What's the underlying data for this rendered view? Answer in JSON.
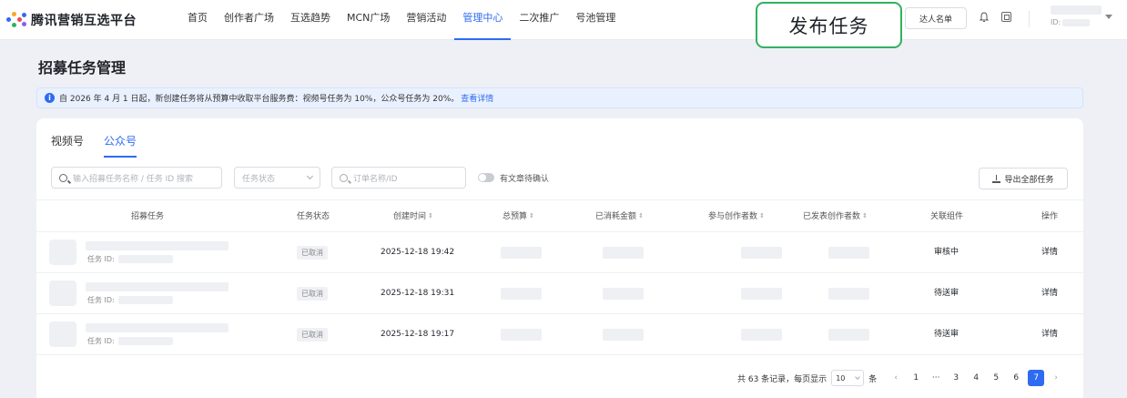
{
  "nav": {
    "logo_text": "腾讯营销互选平台",
    "items": [
      {
        "label": "首页",
        "active": false
      },
      {
        "label": "创作者广场",
        "active": false
      },
      {
        "label": "互选趋势",
        "active": false
      },
      {
        "label": "MCN广场",
        "active": false
      },
      {
        "label": "营销活动",
        "active": false
      },
      {
        "label": "管理中心",
        "active": true
      },
      {
        "label": "二次推广",
        "active": false
      },
      {
        "label": "号池管理",
        "active": false
      }
    ],
    "publish_label": "发布任务",
    "talent_list_label": "达人名单",
    "user_id_prefix": "ID:"
  },
  "page": {
    "title": "招募任务管理"
  },
  "notice": {
    "icon": "info-icon",
    "text": "自 2026 年 4 月 1 日起，新创建任务将从预算中收取平台服务费：视频号任务为 10%，公众号任务为 20%。",
    "link_text": "查看详情"
  },
  "tabs": [
    {
      "label": "视频号",
      "active": false
    },
    {
      "label": "公众号",
      "active": true
    }
  ],
  "filters": {
    "search_placeholder": "输入招募任务名称 / 任务 ID 搜索",
    "status_placeholder": "任务状态",
    "order_placeholder": "订单名称/ID",
    "toggle_label": "有文章待确认",
    "export_label": "导出全部任务"
  },
  "table": {
    "headers": {
      "task": "招募任务",
      "status": "任务状态",
      "created": "创建时间",
      "budget": "总预算",
      "consumed": "已消耗金额",
      "participants": "参与创作者数",
      "published": "已发表创作者数",
      "component": "关联组件",
      "action": "操作"
    },
    "task_id_label": "任务 ID:",
    "rows": [
      {
        "status": "已取消",
        "created": "2025-12-18 19:42",
        "component": "审核中",
        "action": "详情"
      },
      {
        "status": "已取消",
        "created": "2025-12-18 19:31",
        "component": "待送审",
        "action": "详情"
      },
      {
        "status": "已取消",
        "created": "2025-12-18 19:17",
        "component": "待送审",
        "action": "详情"
      }
    ]
  },
  "pagination": {
    "summary": "共 63 条记录，每页显示",
    "page_size": "10",
    "unit": "条",
    "pages": [
      "1",
      "···",
      "3",
      "4",
      "5",
      "6",
      "7"
    ],
    "current": "7",
    "prev": "‹",
    "next": "›"
  },
  "colors": {
    "accent": "#2e6bf2",
    "publish_border": "#2fb25e"
  }
}
